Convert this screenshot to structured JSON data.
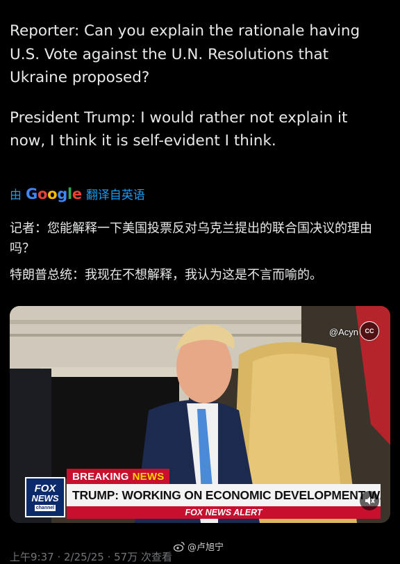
{
  "post": {
    "paragraphs": [
      "Reporter: Can you explain the rationale having\nU.S. Vote against the U.N. Resolutions that\nUkraine proposed?",
      "President Trump: I would rather not explain it\nnow, I think it is self-evident I think."
    ]
  },
  "translation": {
    "by": "由",
    "brand": "Google",
    "suffix": "翻译自英语",
    "paragraphs": [
      "记者：您能解释一下美国投票反对乌克兰提出的联合国决议的理由吗？",
      "特朗普总统：我现在不想解释，我认为这是不言而喻的。"
    ]
  },
  "video": {
    "handle": "@Acyn",
    "cc_label": "CC",
    "network_logo": [
      "FOX",
      "NEWS",
      "channel"
    ],
    "breaking_label": "BREAKING",
    "breaking_news": "NEWS",
    "headline": "TRUMP: WORKING ON ECONOMIC DEVELOPMENT W/ RUSSIA",
    "alert": "FOX NEWS ALERT",
    "mute_icon": "speaker-muted-icon"
  },
  "watermark": {
    "text": "@卢旭宁",
    "icon": "weibo-icon"
  },
  "meta": {
    "text": "上午9:37 · 2/25/25 · 57万 次查看"
  },
  "colors": {
    "background": "#000000",
    "text": "#e7e9ea",
    "link": "#1d9bf0",
    "fox_red": "#c8102e",
    "fox_blue": "#0b2a6b"
  }
}
